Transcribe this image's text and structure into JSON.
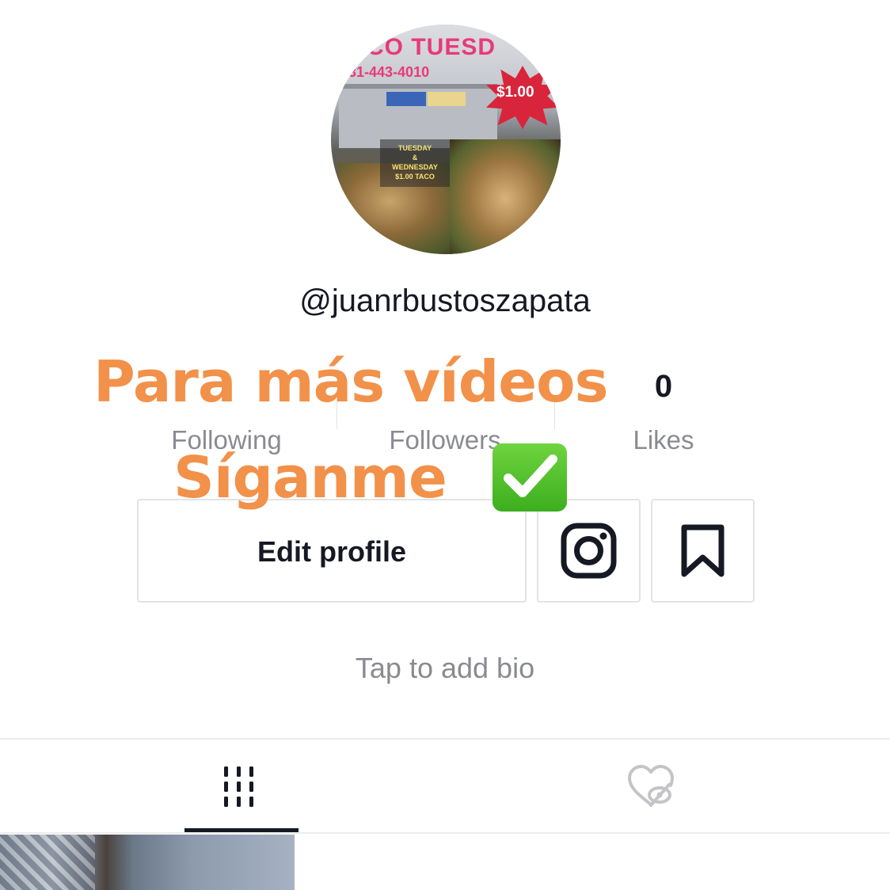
{
  "profile": {
    "avatar": {
      "banner_text": "CO TUESD",
      "phone_text": "31-443-4010",
      "price_text": "$1.00",
      "menu_text": "TUESDAY\n&\nWEDNESDAY\n$1.00 TACO"
    },
    "username": "@juanrbustoszapata",
    "stats": [
      {
        "value": "",
        "label": "Following"
      },
      {
        "value": "",
        "label": "Followers"
      },
      {
        "value": "0",
        "label": "Likes"
      }
    ],
    "edit_profile_label": "Edit profile",
    "bio_placeholder": "Tap to add bio"
  },
  "tabs": [
    {
      "icon": "grid-icon",
      "active": true
    },
    {
      "icon": "liked-videos-private-icon",
      "active": false
    }
  ],
  "overlay": {
    "line1": "Para más vídeos",
    "line2": "Síganme",
    "emoji": "check-mark-button-emoji"
  },
  "colors": {
    "overlay_text": "#f2914a",
    "primary_text": "#161823",
    "secondary_text": "#8a8b91",
    "border": "#e3e3e4",
    "check_green": "#3cae1e"
  }
}
